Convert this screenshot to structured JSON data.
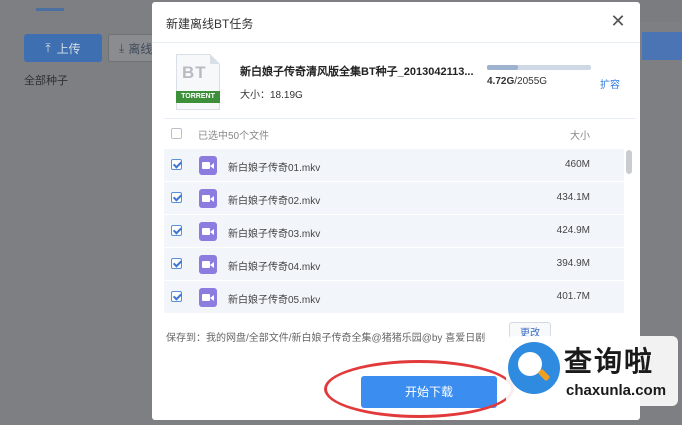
{
  "background": {
    "upload_label": "上传",
    "offline_label": "离线",
    "breadcrumb": "全部种子"
  },
  "dialog": {
    "title": "新建离线BT任务",
    "close_glyph": "✕",
    "torrent": {
      "icon_text": "BT",
      "icon_tag": "TORRENT",
      "name": "新白娘子传奇清风版全集BT种子_2013042113...",
      "size_label": "大小：18.19G"
    },
    "quota": {
      "used": "4.72G",
      "total": "/2055G",
      "used_fraction": 0.0023,
      "expand_label": "扩容"
    },
    "list": {
      "header_label": "已选中50个文件",
      "header_size": "大小",
      "rows": [
        {
          "name": "新白娘子传奇01.mkv",
          "size": "460M",
          "checked": true
        },
        {
          "name": "新白娘子传奇02.mkv",
          "size": "434.1M",
          "checked": true
        },
        {
          "name": "新白娘子传奇03.mkv",
          "size": "424.9M",
          "checked": true
        },
        {
          "name": "新白娘子传奇04.mkv",
          "size": "394.9M",
          "checked": true
        },
        {
          "name": "新白娘子传奇05.mkv",
          "size": "401.7M",
          "checked": true
        }
      ]
    },
    "save_to": "保存到：我的网盘/全部文件/新白娘子传奇全集@猪猪乐园@by 喜爱日剧",
    "change_label": "更改",
    "start_label": "开始下载"
  },
  "watermark": {
    "title": "查询啦",
    "subtitle": "chaxunla.com"
  },
  "colors": {
    "accent": "#3b8ef0",
    "video_icon": "#8d7ce0",
    "annotation": "#e23a3a"
  }
}
